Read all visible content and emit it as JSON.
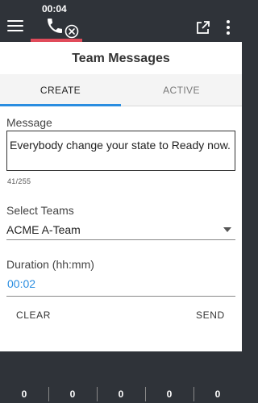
{
  "header": {
    "call_timer": "00:04"
  },
  "panel": {
    "title": "Team Messages",
    "tabs": [
      {
        "label": "CREATE",
        "selected": true
      },
      {
        "label": "ACTIVE",
        "selected": false
      }
    ],
    "message": {
      "label": "Message",
      "value": "Everybody change your state to Ready now.",
      "counter": "41/255"
    },
    "teams": {
      "label": "Select Teams",
      "selected": "ACME A-Team"
    },
    "duration": {
      "label": "Duration (hh:mm)",
      "value": "00:02"
    },
    "actions": {
      "clear": "CLEAR",
      "send": "SEND"
    }
  },
  "stats": [
    "0",
    "0",
    "0",
    "0",
    "0"
  ],
  "colors": {
    "accent": "#2a8de0",
    "topbar": "#2f3339",
    "call_active": "#e04b5a"
  },
  "icons": [
    "menu-icon",
    "phone-icon",
    "end-call-icon",
    "popout-icon",
    "more-vert-icon",
    "dropdown-caret-icon"
  ]
}
